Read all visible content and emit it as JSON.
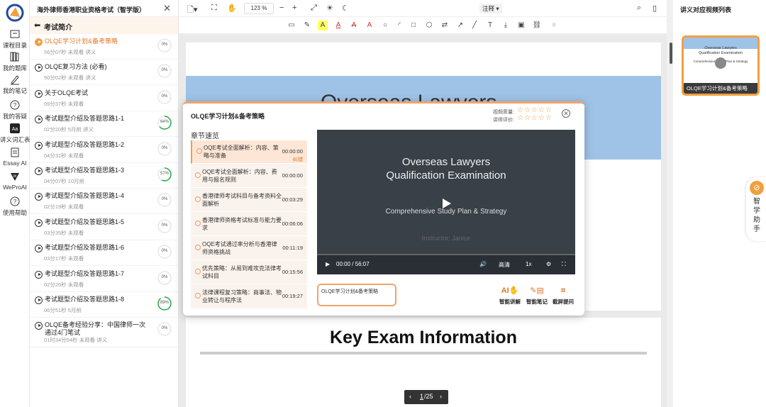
{
  "rail": [
    {
      "label": "课程目录",
      "icon": "catalog-icon"
    },
    {
      "label": "我的题库",
      "icon": "question-bank-icon"
    },
    {
      "label": "我的笔记",
      "icon": "pen-icon"
    },
    {
      "label": "我的答疑",
      "icon": "question-icon"
    },
    {
      "label": "讲义词汇表",
      "icon": "glossary-icon"
    },
    {
      "label": "Essay AI",
      "icon": "essay-icon"
    },
    {
      "label": "WeProAI",
      "icon": "weproai-icon"
    },
    {
      "label": "使用帮助",
      "icon": "help-icon"
    }
  ],
  "panel": {
    "title": "海外律师香港职业资格考试（智学版）",
    "section": "考试简介",
    "lessons": [
      {
        "title": "OLQE学习计划&备考策略",
        "meta": "56分07秒   未观看   讲义",
        "progress": 0,
        "progress_label": "0%",
        "active": true
      },
      {
        "title": "OLQE复习方法 (必看)",
        "meta": "50分02秒   未观看   讲义",
        "progress": 0,
        "progress_label": "0%"
      },
      {
        "title": "关于OLQE考试",
        "meta": "09分37秒   未观看",
        "progress": 0,
        "progress_label": "0%"
      },
      {
        "title": "考试题型介绍及答题思路1-1",
        "meta": "02分20秒   5月前   讲义",
        "progress": 64,
        "progress_label": "64%"
      },
      {
        "title": "考试题型介绍及答题思路1-2",
        "meta": "04分31秒   未观看",
        "progress": 0,
        "progress_label": "0%"
      },
      {
        "title": "考试题型介绍及答题思路1-3",
        "meta": "04分07秒   10月前",
        "progress": 57,
        "progress_label": "57%"
      },
      {
        "title": "考试题型介绍及答题思路1-4",
        "meta": "02分19秒   未观看",
        "progress": 0,
        "progress_label": "0%"
      },
      {
        "title": "考试题型介绍及答题思路1-5",
        "meta": "03分35秒   未观看",
        "progress": 0,
        "progress_label": "0%"
      },
      {
        "title": "考试题型介绍及答题思路1-6",
        "meta": "03分17秒   未观看",
        "progress": 0,
        "progress_label": "0%"
      },
      {
        "title": "考试题型介绍及答题思路1-7",
        "meta": "02分26秒   未观看",
        "progress": 0,
        "progress_label": "0%"
      },
      {
        "title": "考试题型介绍及答题思路1-8",
        "meta": "06分51秒   5月前",
        "progress": 89,
        "progress_label": "89%"
      },
      {
        "title": "OLQE备考经验分享：中国律师一次通过4门笔试",
        "meta": "01时34分04秒   未观看   讲义",
        "progress": 0,
        "progress_label": "0%"
      }
    ]
  },
  "toolbar": {
    "zoom": "123 %",
    "annotate": "注释 ▾"
  },
  "document": {
    "page1_heading": "Overseas Lawyers",
    "page2_heading": "Key Exam Information",
    "pager": {
      "current": "1",
      "total": "/25"
    }
  },
  "right_panel": {
    "title": "讲义对应视频列表",
    "thumb_caption": "OLQE学习计划&备考策略",
    "thumb_line1": "Overseas Lawyers",
    "thumb_line2": "Qualification Examination",
    "thumb_line3": "Comprehensive Study Plan & Strategy",
    "assistant": [
      "智",
      "学",
      "助",
      "手"
    ]
  },
  "modal": {
    "title": "OLQE学习计划&备考策略",
    "rate_video": "视频质量:",
    "rate_teacher": "讲师评价:",
    "chapters_title": "章节速览",
    "chapters": [
      {
        "title": "OQE考试全面解析：内容、策略与准备",
        "time": "00:00:00",
        "extra": "纠错",
        "active": true
      },
      {
        "title": "OQE考试全面解析：内容、费用与报名规则",
        "time": "00:00:00"
      },
      {
        "title": "香港律师考试科目与备考资料全面解析",
        "time": "00:03:29"
      },
      {
        "title": "香港律师资格考试标准与能力要求",
        "time": "00:06:06"
      },
      {
        "title": "OQE考试通过率分析与香港律师资格挑战",
        "time": "00:11:19"
      },
      {
        "title": "优先策略：从易到难攻克法律考试科目",
        "time": "00:15:56"
      },
      {
        "title": "法律课程复习策略：商事法、物业转让与程序法",
        "time": "00:19:27"
      }
    ],
    "video": {
      "line1": "Overseas Lawyers",
      "line2": "Qualification Examination",
      "line3": "Comprehensive Study Plan & Strategy",
      "line4": "Instructor: Janice",
      "time": "00:00 / 56:07",
      "quality": "高清",
      "speed": "1x"
    },
    "note_text": "OLQE学习计划&备考策略",
    "actions": [
      {
        "label": "智能讲解",
        "icon": "ai-explain-icon"
      },
      {
        "label": "智能笔记",
        "icon": "ai-note-icon"
      },
      {
        "label": "截屏提问",
        "icon": "screenshot-ask-icon"
      }
    ]
  },
  "colors": {
    "accent": "#f0a040",
    "band": "#9fc3e7",
    "video_bg": "#3a4048"
  }
}
